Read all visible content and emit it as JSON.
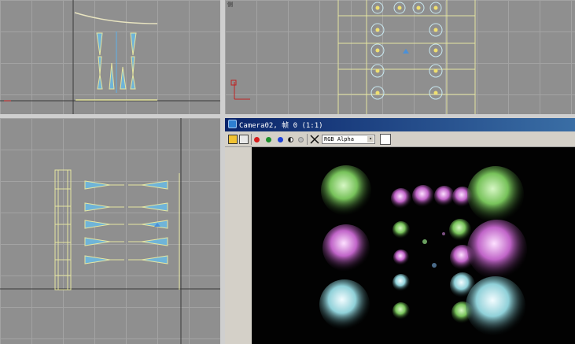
{
  "viewports": {
    "top_left_label": "",
    "top_right_label": "侧",
    "bottom_left_label": "",
    "axis_label": "x"
  },
  "render_window": {
    "title": "Camera02, 帧 0 (1:1)",
    "channel": "RGB Alpha",
    "chevron": "▾",
    "icons": [
      "save-icon",
      "clone-icon",
      "red-channel-icon",
      "green-channel-icon",
      "blue-channel-icon",
      "alpha-monochrome-icon",
      "clear-icon",
      "close-x-icon"
    ]
  }
}
